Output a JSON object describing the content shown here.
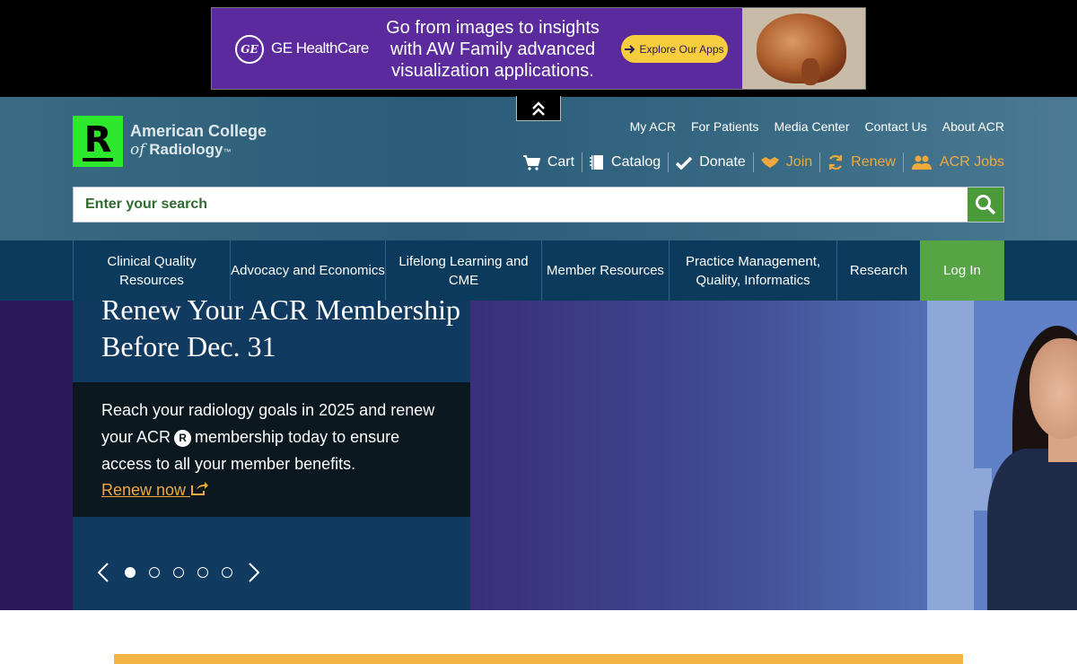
{
  "ad": {
    "brand": "GE HealthCare",
    "logo_text": "GE",
    "headline": "Go from images to insights with AW Family advanced visualization applications.",
    "cta": "Explore Our Apps"
  },
  "header": {
    "logo_line1": "American College",
    "logo_line2_prefix": "of",
    "logo_line2": "Radiology",
    "logo_tm": "™",
    "utility_links": [
      "My ACR",
      "For Patients",
      "Media Center",
      "Contact Us",
      "About ACR"
    ],
    "actions": [
      {
        "label": "Cart",
        "icon": "cart-icon",
        "color": "#ffffff"
      },
      {
        "label": "Catalog",
        "icon": "catalog-icon",
        "color": "#ffffff"
      },
      {
        "label": "Donate",
        "icon": "check-icon",
        "color": "#ffffff"
      },
      {
        "label": "Join",
        "icon": "handshake-icon",
        "color": "#f0a93c"
      },
      {
        "label": "Renew",
        "icon": "refresh-icon",
        "color": "#f0a93c"
      },
      {
        "label": "ACR Jobs",
        "icon": "people-icon",
        "color": "#f0a93c"
      }
    ],
    "search_placeholder": "Enter your search"
  },
  "nav": {
    "items": [
      "Clinical Quality Resources",
      "Advocacy and Economics",
      "Lifelong Learning and CME",
      "Member Resources",
      "Practice Management, Quality, Informatics",
      "Research"
    ],
    "login": "Log In"
  },
  "hero": {
    "title": "Renew Your ACR Membership Before Dec. 31",
    "body_before": "Reach your radiology goals in 2025 and renew your ACR",
    "body_after": "membership today to ensure access to all your member benefits.",
    "link": "Renew now",
    "slide_count": 5,
    "active_slide": 1
  },
  "colors": {
    "brand_green": "#2ee82e",
    "accent_gold": "#f0a93c",
    "nav_blue": "#0b3a5c",
    "login_green": "#55a545",
    "ad_purple": "#5b2b9e"
  }
}
